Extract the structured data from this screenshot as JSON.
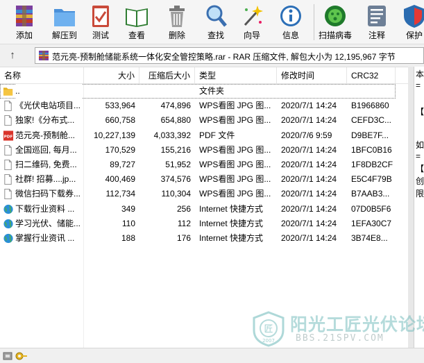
{
  "toolbar": {
    "buttons": [
      {
        "label": "添加",
        "icon": "add-archive-icon"
      },
      {
        "label": "解压到",
        "icon": "extract-folder-icon"
      },
      {
        "label": "测试",
        "icon": "test-clipboard-icon"
      },
      {
        "label": "查看",
        "icon": "view-book-icon"
      },
      {
        "label": "删除",
        "icon": "trash-icon"
      },
      {
        "label": "查找",
        "icon": "magnifier-icon"
      },
      {
        "label": "向导",
        "icon": "wizard-wand-icon"
      },
      {
        "label": "信息",
        "icon": "info-icon"
      },
      {
        "label": "扫描病毒",
        "icon": "virus-scan-icon"
      },
      {
        "label": "注释",
        "icon": "comment-icon"
      },
      {
        "label": "保护",
        "icon": "shield-protect-icon"
      }
    ]
  },
  "address": {
    "path": "范元亮-预制舱储能系统一体化安全管控策略.rar - RAR 压缩文件, 解包大小为 12,195,967 字节"
  },
  "columns": {
    "name": "名称",
    "size": "大小",
    "packed": "压缩后大小",
    "type": "类型",
    "modified": "修改时间",
    "crc": "CRC32"
  },
  "rows": [
    {
      "name": "..",
      "size": "",
      "packed": "",
      "type": "文件夹",
      "modified": "",
      "crc": "",
      "icon": "folder-icon"
    },
    {
      "name": "《光伏电站项目...",
      "size": "533,964",
      "packed": "474,896",
      "type": "WPS看图 JPG 图...",
      "modified": "2020/7/1 14:24",
      "crc": "B1966860",
      "icon": "image-file-icon"
    },
    {
      "name": "独家!《分布式...",
      "size": "660,758",
      "packed": "654,880",
      "type": "WPS看图 JPG 图...",
      "modified": "2020/7/1 14:24",
      "crc": "CEFD3C...",
      "icon": "image-file-icon"
    },
    {
      "name": "范元亮-预制舱...",
      "size": "10,227,139",
      "packed": "4,033,392",
      "type": "PDF 文件",
      "modified": "2020/7/6 9:59",
      "crc": "D9BE7F...",
      "icon": "pdf-file-icon"
    },
    {
      "name": "全国巡回, 每月...",
      "size": "170,529",
      "packed": "155,216",
      "type": "WPS看图 JPG 图...",
      "modified": "2020/7/1 14:24",
      "crc": "1BFC0B16",
      "icon": "image-file-icon"
    },
    {
      "name": "扫二维码, 免费...",
      "size": "89,727",
      "packed": "51,952",
      "type": "WPS看图 JPG 图...",
      "modified": "2020/7/1 14:24",
      "crc": "1F8DB2CF",
      "icon": "image-file-icon"
    },
    {
      "name": "社群! 招募....jp...",
      "size": "400,469",
      "packed": "374,576",
      "type": "WPS看图 JPG 图...",
      "modified": "2020/7/1 14:24",
      "crc": "E5C4F79B",
      "icon": "image-file-icon"
    },
    {
      "name": "微信扫码下载券...",
      "size": "112,734",
      "packed": "110,304",
      "type": "WPS看图 JPG 图...",
      "modified": "2020/7/1 14:24",
      "crc": "B7AAB3...",
      "icon": "image-file-icon"
    },
    {
      "name": "下载行业资料 ...",
      "size": "349",
      "packed": "256",
      "type": "Internet 快捷方式",
      "modified": "2020/7/1 14:24",
      "crc": "07D0B5F6",
      "icon": "internet-shortcut-icon"
    },
    {
      "name": "学习光伏、储能...",
      "size": "110",
      "packed": "112",
      "type": "Internet 快捷方式",
      "modified": "2020/7/1 14:24",
      "crc": "1EFA30C7",
      "icon": "internet-shortcut-icon"
    },
    {
      "name": "掌握行业资讯 ...",
      "size": "188",
      "packed": "176",
      "type": "Internet 快捷方式",
      "modified": "2020/7/1 14:24",
      "crc": "3B74E8...",
      "icon": "internet-shortcut-icon"
    }
  ],
  "preview": {
    "lines": [
      "本",
      "=",
      "【",
      "如",
      "=",
      "【",
      "创",
      "限"
    ]
  },
  "watermark": {
    "title": "阳光工匠光伏论坛",
    "url": "BBS.21SPV.COM",
    "year": "2007",
    "seal_char": "匠"
  },
  "colors": {
    "folder": "#f5c542",
    "pdf": "#d9342b",
    "globe": "#2a8fd6",
    "watermark": "#78bebe"
  }
}
